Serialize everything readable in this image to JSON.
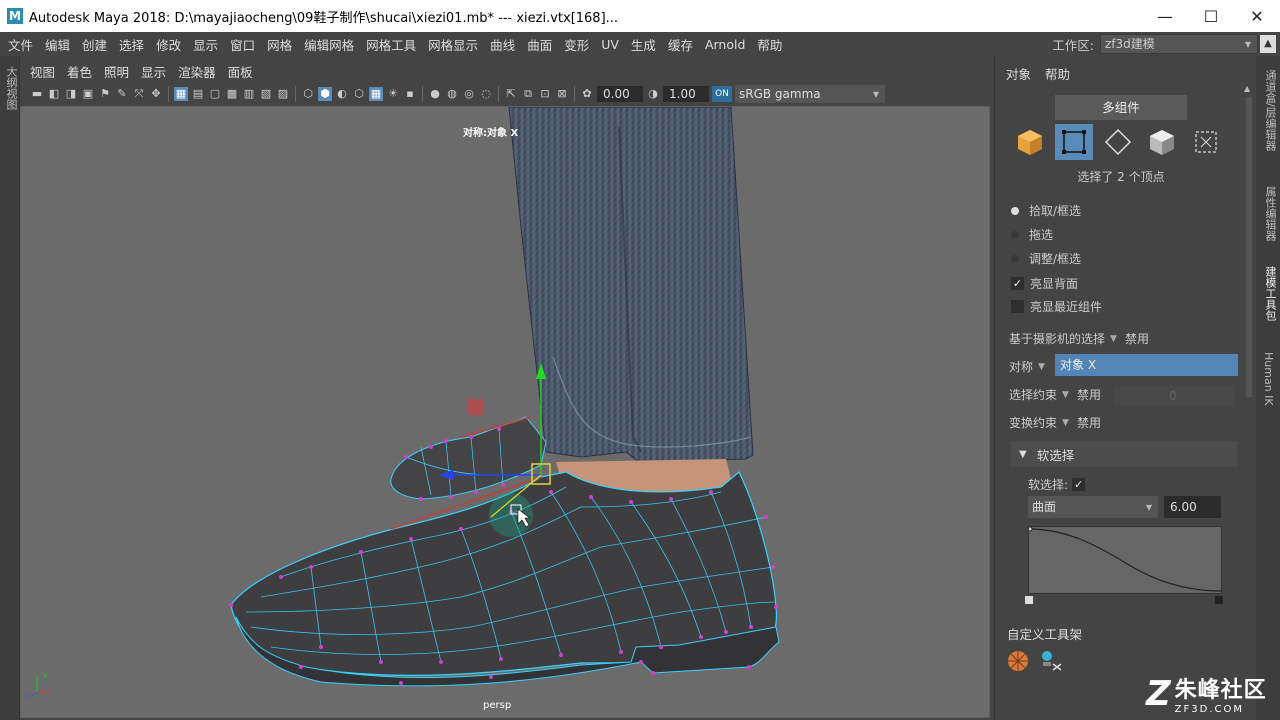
{
  "window": {
    "title": "Autodesk Maya 2018: D:\\mayajiaocheng\\09鞋子制作\\shucai\\xiezi01.mb*   ---   xiezi.vtx[168]...",
    "logo": "M"
  },
  "menu": [
    "文件",
    "编辑",
    "创建",
    "选择",
    "修改",
    "显示",
    "窗口",
    "网格",
    "编辑网格",
    "网格工具",
    "网格显示",
    "曲线",
    "曲面",
    "变形",
    "UV",
    "生成",
    "缓存",
    "Arnold",
    "帮助"
  ],
  "workspace": {
    "label": "工作区:",
    "value": "zf3d建模"
  },
  "left_strip": {
    "label": "大纲视图"
  },
  "viewport": {
    "menu": [
      "视图",
      "着色",
      "照明",
      "显示",
      "渲染器",
      "面板"
    ],
    "exposure": "0.00",
    "gamma": "1.00",
    "color_space": "sRGB gamma",
    "color_space_icon": "ON",
    "symmetry_label": "对称:对象 X",
    "camera": "persp"
  },
  "modeling_toolkit": {
    "menu": [
      "对象",
      "帮助"
    ],
    "multi_tab": "多组件",
    "selection_status": "选择了 2 个顶点",
    "pick_modes": [
      {
        "label": "拾取/框选",
        "selected": true
      },
      {
        "label": "拖选",
        "selected": false
      },
      {
        "label": "调整/框选",
        "selected": false
      }
    ],
    "backface": {
      "label": "亮显背面",
      "checked": true
    },
    "nearest": {
      "label": "亮显最近组件",
      "checked": false
    },
    "camera_based": {
      "label": "基于摄影机的选择",
      "value": "禁用"
    },
    "symmetry": {
      "label": "对称",
      "value": "对象 X"
    },
    "selection_constraint": {
      "label": "选择约束",
      "value": "禁用",
      "number": "0"
    },
    "transform_constraint": {
      "label": "变换约束",
      "value": "禁用"
    },
    "soft_select": {
      "header": "软选择",
      "label": "软选择:",
      "checked": true,
      "falloff_mode": "曲面",
      "falloff_radius": "6.00"
    },
    "custom_shelf": "自定义工具架"
  },
  "right_tabs": [
    "通道盒/层编辑器",
    "属性编辑器",
    "建模工具包",
    "Human IK"
  ],
  "watermark": {
    "cn": "朱峰社区",
    "en": "ZF3D.COM",
    "z": "Z"
  },
  "colors": {
    "accent": "#5a8bb8",
    "viewport_bg": "#6b6b6b",
    "mesh_wire": "#3ad0ff",
    "vertex": "#d040d0"
  }
}
